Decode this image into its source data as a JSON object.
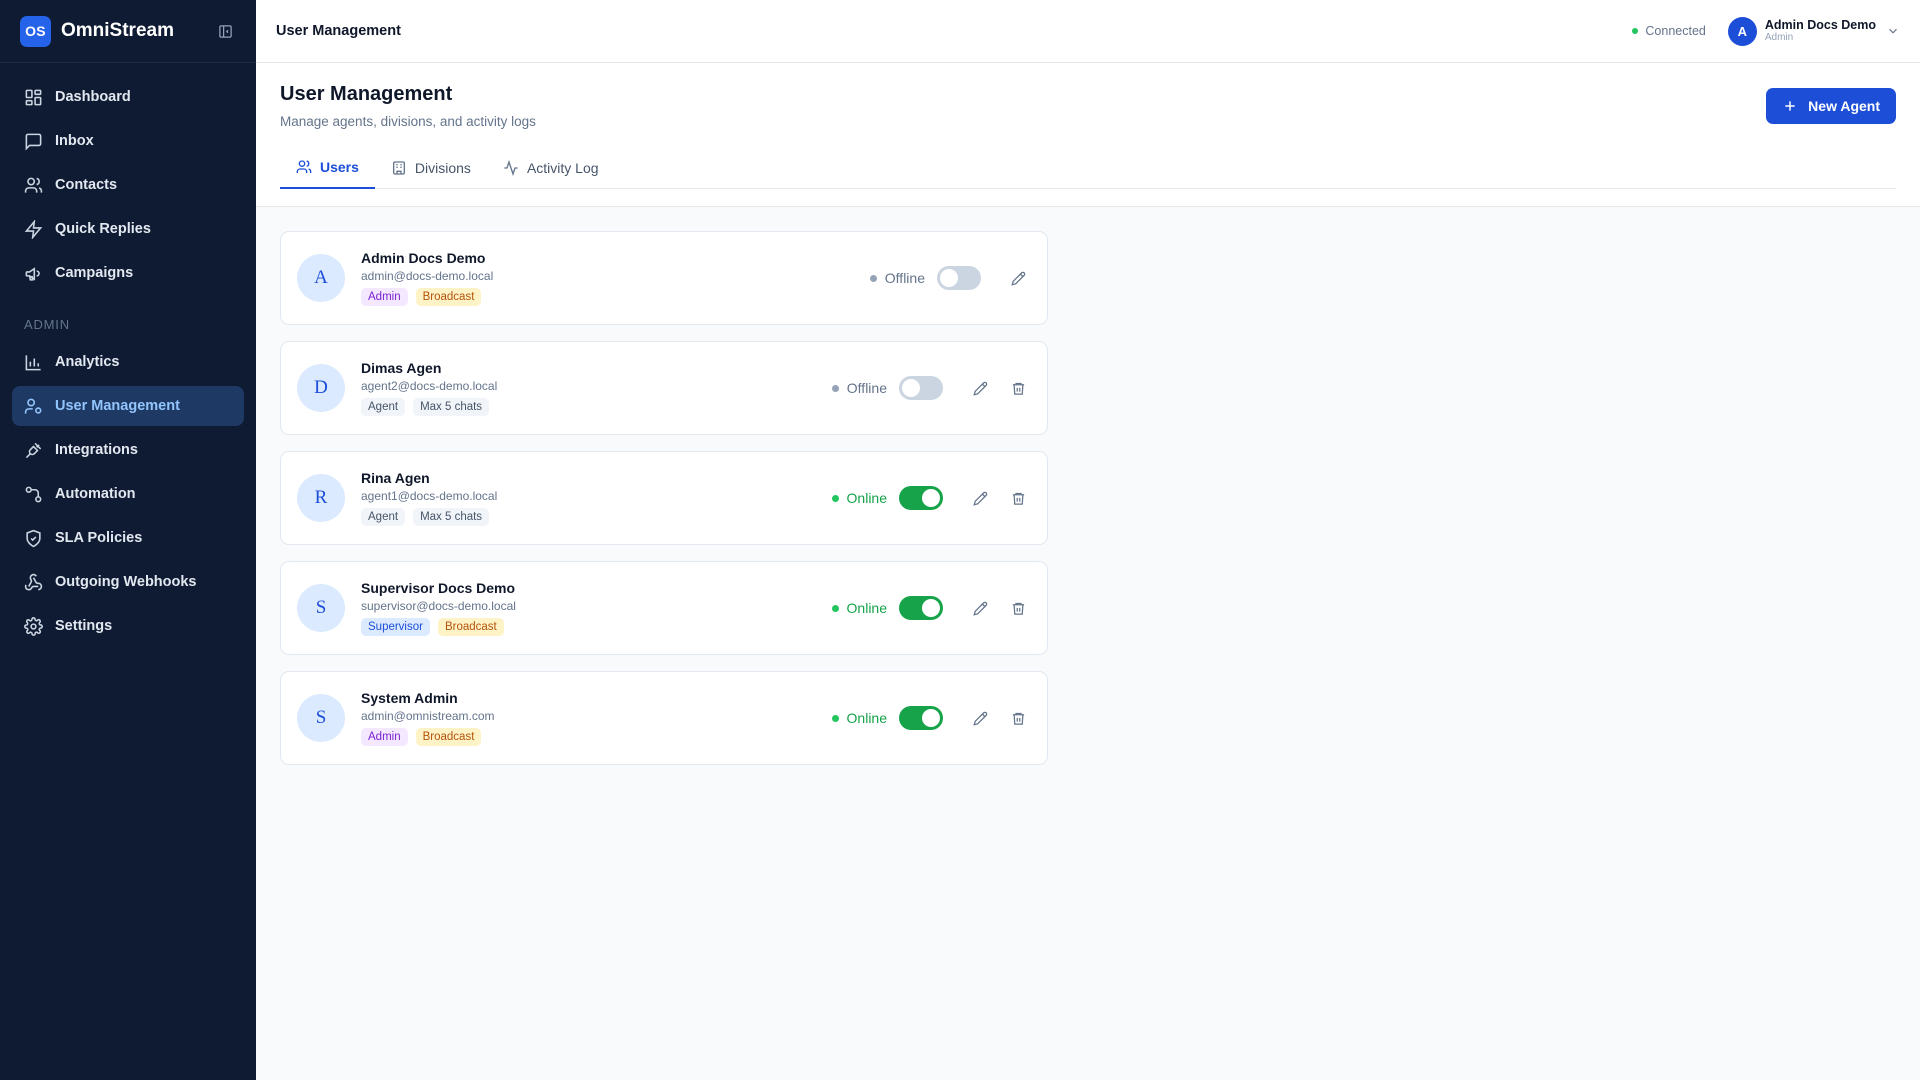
{
  "brand": {
    "logo": "OS",
    "name": "OmniStream"
  },
  "sidebar": {
    "items": [
      {
        "label": "Dashboard",
        "icon": "dashboard-icon"
      },
      {
        "label": "Inbox",
        "icon": "inbox-icon"
      },
      {
        "label": "Contacts",
        "icon": "contacts-icon"
      },
      {
        "label": "Quick Replies",
        "icon": "bolt-icon"
      },
      {
        "label": "Campaigns",
        "icon": "megaphone-icon"
      }
    ],
    "section_label": "ADMIN",
    "admin_items": [
      {
        "label": "Analytics",
        "icon": "bar-chart-icon"
      },
      {
        "label": "User Management",
        "icon": "user-cog-icon",
        "active": true
      },
      {
        "label": "Integrations",
        "icon": "plug-icon"
      },
      {
        "label": "Automation",
        "icon": "workflow-icon"
      },
      {
        "label": "SLA Policies",
        "icon": "shield-icon"
      },
      {
        "label": "Outgoing Webhooks",
        "icon": "webhook-icon"
      },
      {
        "label": "Settings",
        "icon": "gear-icon"
      }
    ]
  },
  "header": {
    "title": "User Management",
    "connection": "Connected",
    "user": {
      "initial": "A",
      "name": "Admin Docs Demo",
      "role": "Admin"
    }
  },
  "page": {
    "title": "User Management",
    "subtitle": "Manage agents, divisions, and activity logs",
    "new_button": "New Agent",
    "tabs": [
      {
        "label": "Users",
        "icon": "users-icon",
        "active": true
      },
      {
        "label": "Divisions",
        "icon": "building-icon"
      },
      {
        "label": "Activity Log",
        "icon": "activity-icon"
      }
    ]
  },
  "users": [
    {
      "initial": "A",
      "name": "Admin Docs Demo",
      "email": "admin@docs-demo.local",
      "badges": [
        [
          "Admin",
          "purple"
        ],
        [
          "Broadcast",
          "amber"
        ]
      ],
      "status": "Offline",
      "online": false,
      "deletable": false
    },
    {
      "initial": "D",
      "name": "Dimas Agen",
      "email": "agent2@docs-demo.local",
      "badges": [
        [
          "Agent",
          "gray"
        ],
        [
          "Max 5 chats",
          "gray"
        ]
      ],
      "status": "Offline",
      "online": false,
      "deletable": true
    },
    {
      "initial": "R",
      "name": "Rina Agen",
      "email": "agent1@docs-demo.local",
      "badges": [
        [
          "Agent",
          "gray"
        ],
        [
          "Max 5 chats",
          "gray"
        ]
      ],
      "status": "Online",
      "online": true,
      "deletable": true
    },
    {
      "initial": "S",
      "name": "Supervisor Docs Demo",
      "email": "supervisor@docs-demo.local",
      "badges": [
        [
          "Supervisor",
          "blue"
        ],
        [
          "Broadcast",
          "amber"
        ]
      ],
      "status": "Online",
      "online": true,
      "deletable": true
    },
    {
      "initial": "S",
      "name": "System Admin",
      "email": "admin@omnistream.com",
      "badges": [
        [
          "Admin",
          "purple"
        ],
        [
          "Broadcast",
          "amber"
        ]
      ],
      "status": "Online",
      "online": true,
      "deletable": true
    }
  ],
  "colors": {
    "sidebar_bg": "#0f1b33",
    "accent": "#1d4ed8",
    "online": "#16a34a",
    "offline": "#94a3b8"
  }
}
